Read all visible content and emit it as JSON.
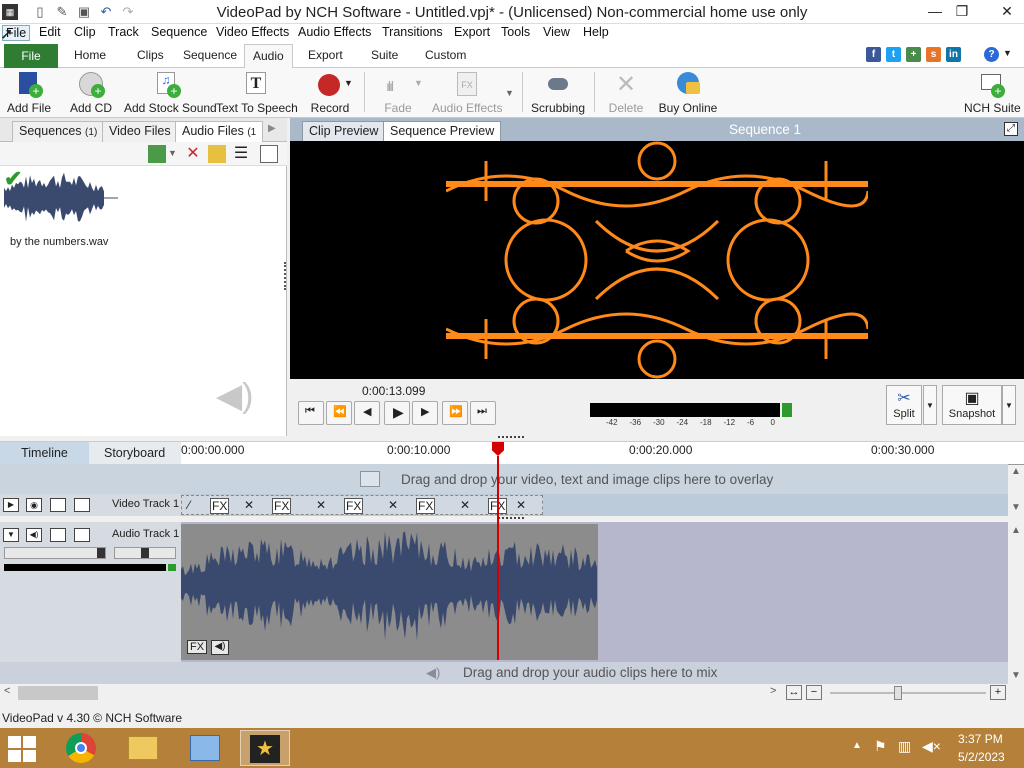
{
  "window": {
    "title": "VideoPad by NCH Software - Untitled.vpj* - (Unlicensed) Non-commercial home use only"
  },
  "menu": [
    "File",
    "Edit",
    "Clip",
    "Track",
    "Sequence",
    "Video Effects",
    "Audio Effects",
    "Transitions",
    "Export",
    "Tools",
    "View",
    "Help"
  ],
  "ribbon": {
    "file_tab": "File",
    "tabs": [
      "Home",
      "Clips",
      "Sequence",
      "Audio",
      "Export",
      "Suite",
      "Custom"
    ],
    "active": "Audio"
  },
  "social": [
    "f",
    "t",
    "+",
    "s",
    "in"
  ],
  "toolbar": {
    "add_file": "Add File",
    "add_cd": "Add CD",
    "add_stock_sound": "Add Stock Sound",
    "text_to_speech": "Text To Speech",
    "record": "Record",
    "fade": "Fade",
    "audio_effects": "Audio Effects",
    "scrubbing": "Scrubbing",
    "delete": "Delete",
    "buy_online": "Buy Online",
    "nch_suite": "NCH Suite"
  },
  "bin": {
    "tabs": [
      {
        "label": "Sequences",
        "count": "(1)"
      },
      {
        "label": "Video Files",
        "count": ""
      },
      {
        "label": "Audio Files",
        "count": "(1"
      }
    ],
    "file_name": "by the numbers.wav"
  },
  "preview": {
    "tabs": [
      "Clip Preview",
      "Sequence Preview"
    ],
    "active": "Sequence Preview",
    "sequence_title": "Sequence 1",
    "time": "0:00:13.099",
    "meter_ticks": [
      "-42",
      "-36",
      "-30",
      "-24",
      "-18",
      "-12",
      "-6",
      "0"
    ],
    "split_label": "Split",
    "snapshot_label": "Snapshot"
  },
  "timeline": {
    "tabs": [
      "Timeline",
      "Storyboard"
    ],
    "active": "Timeline",
    "ruler": [
      "0:00:00.000",
      "0:00:10.000",
      "0:00:20.000",
      "0:00:30.000"
    ],
    "overlay_hint": "Drag and drop your video, text and image clips here to overlay",
    "video_track": "Video Track 1",
    "audio_track": "Audio Track 1",
    "mix_hint": "Drag and drop your audio clips here to mix",
    "fx_label": "FX",
    "playhead_seconds": 13.1
  },
  "status": {
    "version": "VideoPad v 4.30 © NCH Software"
  },
  "taskbar": {
    "time": "3:37 PM",
    "date": "5/2/2023"
  },
  "colors": {
    "orange": "#ff8a1a",
    "waveform": "#3a4a6e",
    "playhead": "#d40000",
    "file_green": "#2e7d32"
  }
}
